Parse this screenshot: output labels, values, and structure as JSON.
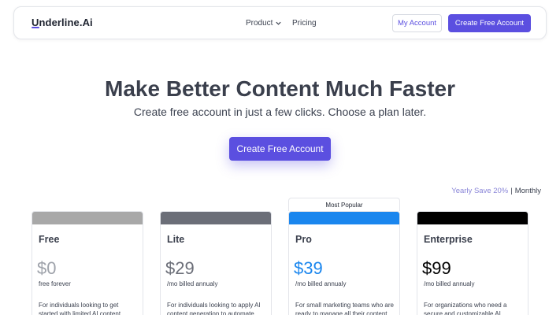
{
  "header": {
    "logo": "Underline.Ai",
    "nav": {
      "product": "Product",
      "pricing": "Pricing"
    },
    "my_account": "My Account",
    "create_account": "Create Free Account"
  },
  "hero": {
    "title": "Make Better Content Much Faster",
    "subtitle": "Create free account in just a few clicks. Choose a plan later.",
    "cta": "Create Free Account"
  },
  "billing": {
    "yearly": "Yearly Save 20%",
    "separator": "|",
    "monthly": "Monthly"
  },
  "plans": [
    {
      "name": "Free",
      "price": "$0",
      "period": "free forever",
      "desc": "For individuals looking to get started with limited AI content",
      "bar_color": "#a8a8a8",
      "price_color": "#9ea2aa"
    },
    {
      "name": "Lite",
      "price": "$29",
      "period": "/mo billed annualy",
      "desc": "For individuals looking to apply AI content generation to automate",
      "bar_color": "#6b6e78",
      "price_color": "#6b6e78"
    },
    {
      "name": "Pro",
      "price": "$39",
      "period": "/mo billed annualy",
      "desc": "For small marketing teams who are ready to manage all their content",
      "bar_color": "#1a86ee",
      "price_color": "#1a86ee",
      "tag": "Most Popular"
    },
    {
      "name": "Enterprise",
      "price": "$99",
      "period": "/mo billed annualy",
      "desc": "For organizations who need a secure and customizable AI",
      "bar_color": "#000000",
      "price_color": "#000000"
    }
  ],
  "colors": {
    "accent": "#5b4fe0",
    "text": "#3c4250"
  },
  "icons": {
    "product_dropdown": "chevron-down-icon"
  }
}
